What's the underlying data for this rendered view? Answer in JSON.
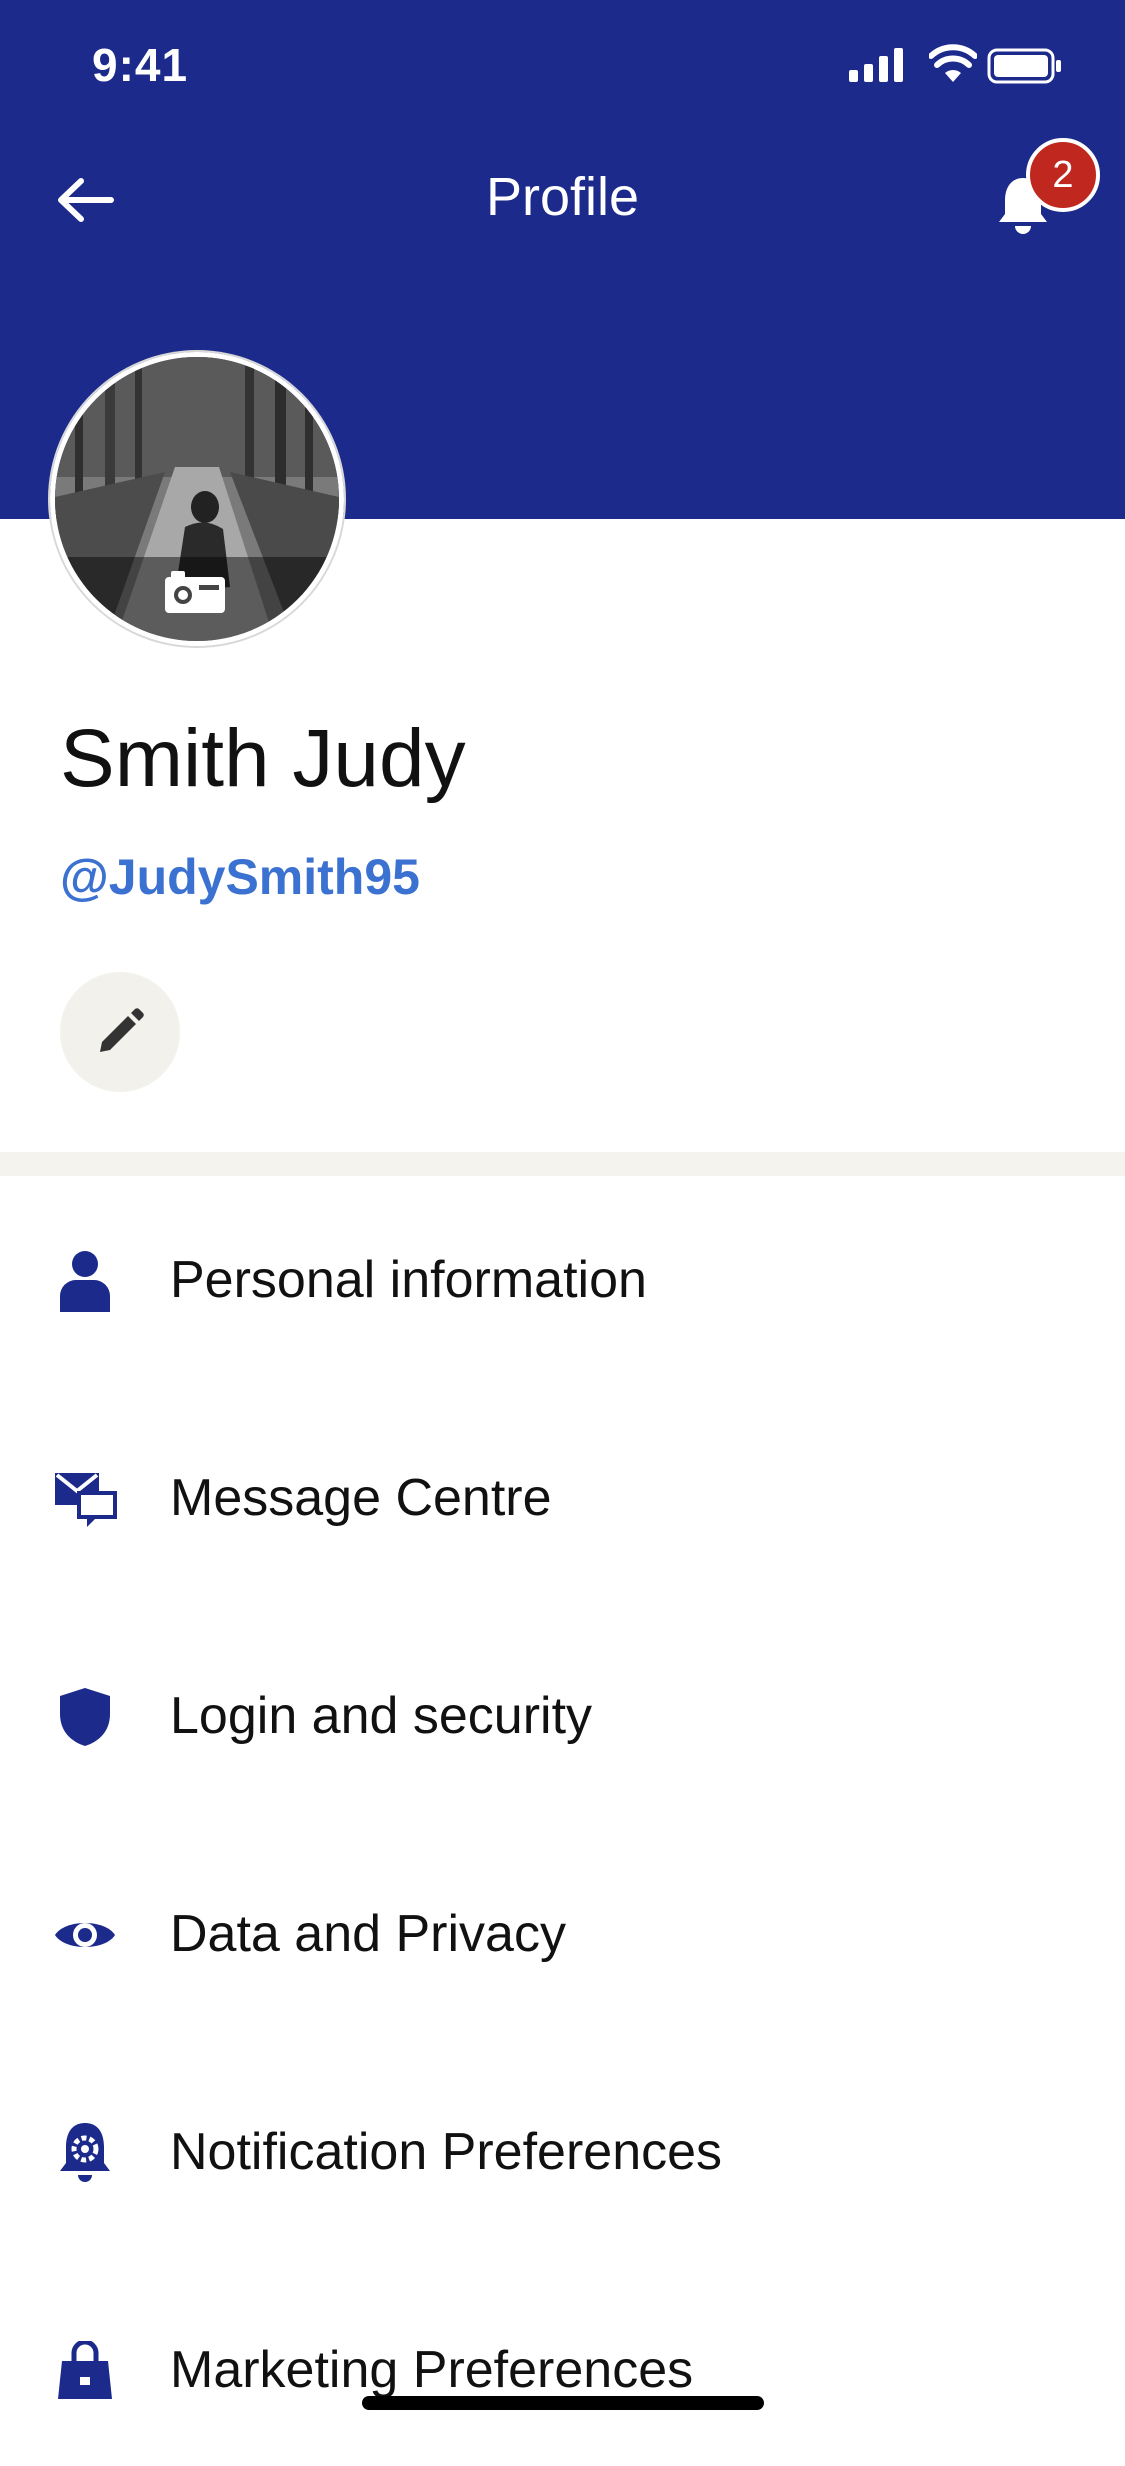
{
  "status_bar": {
    "time": "9:41"
  },
  "nav": {
    "title": "Profile",
    "notification_count": "2",
    "back_icon": "arrow-left-icon",
    "bell_icon": "bell-icon"
  },
  "profile": {
    "name": "Smith Judy",
    "handle": "@JudySmith95",
    "avatar_icon": "camera-icon",
    "edit_icon": "pencil-icon"
  },
  "menu": {
    "items": [
      {
        "label": "Personal information",
        "icon": "person-icon"
      },
      {
        "label": "Message Centre",
        "icon": "message-icon"
      },
      {
        "label": "Login and security",
        "icon": "shield-icon"
      },
      {
        "label": "Data and Privacy",
        "icon": "eye-icon"
      },
      {
        "label": "Notification Preferences",
        "icon": "bell-gear-icon"
      },
      {
        "label": "Marketing Preferences",
        "icon": "shopping-bag-icon"
      }
    ]
  },
  "colors": {
    "brand": "#1b2a8b",
    "accent_link": "#3b71d0",
    "badge": "#c0281f",
    "icon": "#1b2a8b"
  }
}
